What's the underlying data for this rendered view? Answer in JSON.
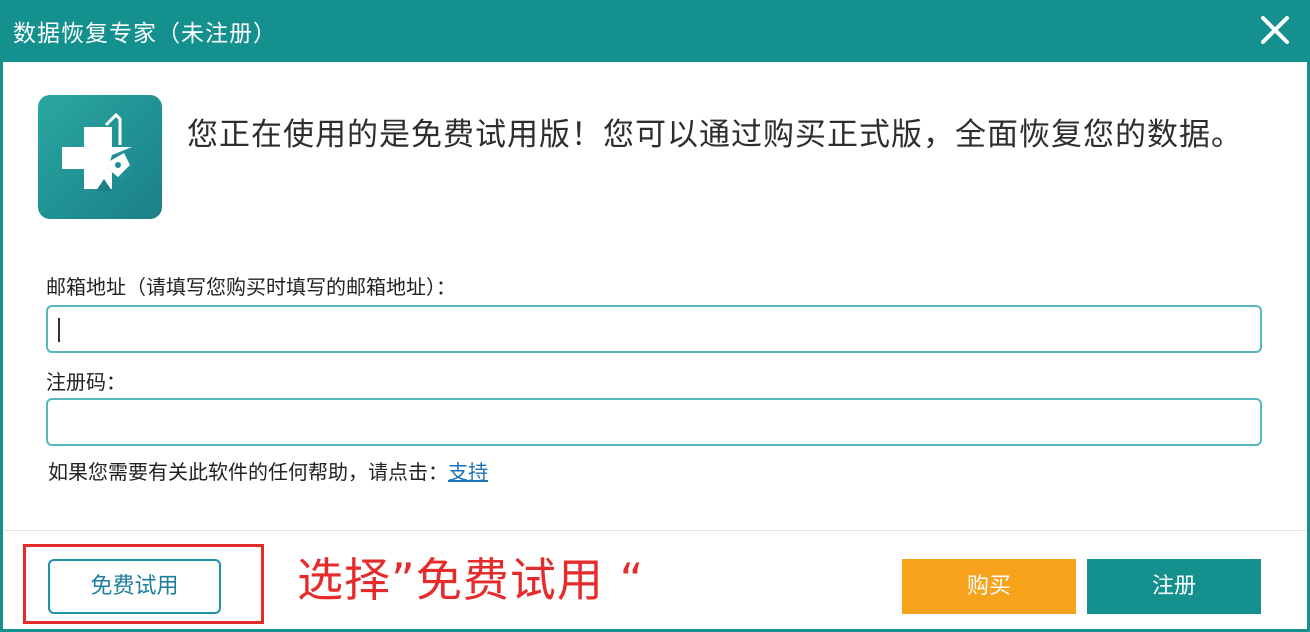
{
  "window": {
    "title": "数据恢复专家（未注册）"
  },
  "colors": {
    "titlebar": "#14918f",
    "input_border": "#58b6c0",
    "buy_button": "#f7a21b",
    "register_button": "#14918f",
    "trial_border": "#1e90a8",
    "link": "#1a73b8",
    "annotation": "#e52b2b"
  },
  "icons": {
    "close": "close-icon",
    "logo": "medical-cross-repair-logo"
  },
  "message": {
    "headline": "您正在使用的是免费试用版！您可以通过购买正式版，全面恢复您的数据。"
  },
  "form": {
    "email_label": "邮箱地址（请填写您购买时填写的邮箱地址）：",
    "email_value": "",
    "code_label": "注册码：",
    "code_value": ""
  },
  "help": {
    "text": "如果您需要有关此软件的任何帮助，请点击：",
    "link_label": "支持"
  },
  "buttons": {
    "trial_label": "免费试用",
    "buy_label": "购买",
    "register_label": "注册"
  },
  "annotation": {
    "text": "选择”免费试用 “"
  }
}
